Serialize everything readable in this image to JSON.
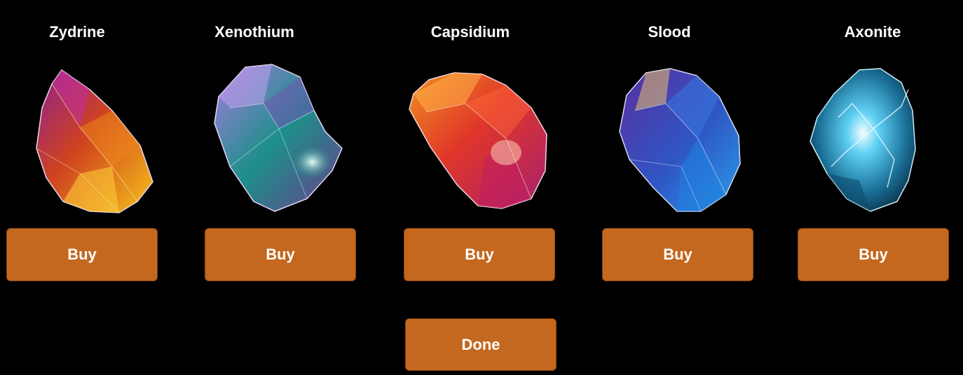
{
  "shop": {
    "items": [
      {
        "name": "Zydrine",
        "buy_label": "Buy",
        "icon": "zydrine-gem-icon",
        "colors": [
          "#8e1f8f",
          "#d0431f",
          "#f5c21a"
        ]
      },
      {
        "name": "Xenothium",
        "buy_label": "Buy",
        "icon": "xenothium-gem-icon",
        "colors": [
          "#8a55c8",
          "#1d8f8a",
          "#b6f0d0"
        ]
      },
      {
        "name": "Capsidium",
        "buy_label": "Buy",
        "icon": "capsidium-gem-icon",
        "colors": [
          "#e0681e",
          "#d8234f",
          "#a8206e"
        ]
      },
      {
        "name": "Slood",
        "buy_label": "Buy",
        "icon": "slood-gem-icon",
        "colors": [
          "#5b2ea0",
          "#2f56c4",
          "#2a9be8"
        ]
      },
      {
        "name": "Axonite",
        "buy_label": "Buy",
        "icon": "axonite-gem-icon",
        "colors": [
          "#0e4d6e",
          "#2fa8d8",
          "#e8fbff"
        ]
      }
    ],
    "done_label": "Done",
    "button_color": "#c4681f",
    "background_color": "#000000"
  }
}
